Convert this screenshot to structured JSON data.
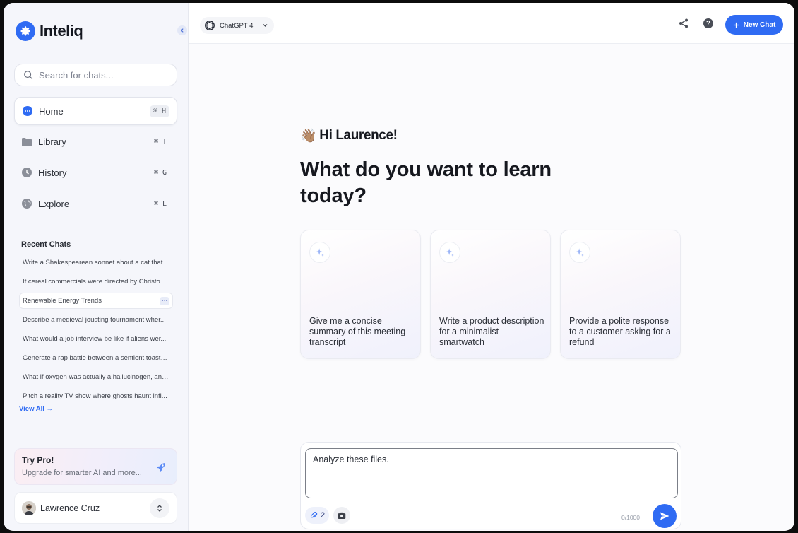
{
  "app": {
    "name": "Inteliq",
    "accent": "#2f6bf3"
  },
  "sidebar": {
    "search_placeholder": "Search for chats...",
    "nav": [
      {
        "label": "Home",
        "shortcut": "⌘ H",
        "icon": "chat-bubble-icon",
        "active": true
      },
      {
        "label": "Library",
        "shortcut": "⌘ T",
        "icon": "folder-icon"
      },
      {
        "label": "History",
        "shortcut": "⌘ G",
        "icon": "clock-icon"
      },
      {
        "label": "Explore",
        "shortcut": "⌘ L",
        "icon": "globe-icon"
      }
    ],
    "recent_title": "Recent Chats",
    "recent": [
      "Write a Shakespearean sonnet about a cat that...",
      "If cereal commercials were directed by Christo...",
      "Renewable Energy Trends",
      "Describe a medieval jousting tournament wher...",
      "What would a job interview be like if aliens wer...",
      "Generate a rap battle between a sentient toaste...",
      "What if oxygen was actually a hallucinogen, and...",
      "Pitch a reality TV show where ghosts haunt infl..."
    ],
    "recent_selected_more": "···",
    "view_all": "View All →",
    "pro": {
      "title": "Try Pro!",
      "subtitle": "Upgrade for smarter AI and more...",
      "icon": "rocket-icon"
    },
    "user": {
      "name": "Lawrence Cruz"
    }
  },
  "topbar": {
    "model": "ChatGPT 4",
    "new_chat": "New Chat",
    "help": "?"
  },
  "main": {
    "greeting_emoji": "👋🏽",
    "greeting": "Hi Laurence!",
    "headline": "What do you want to learn today?",
    "cards": [
      "Give me a concise summary of this meeting transcript",
      "Write a product description for a minimalist smartwatch",
      "Provide a polite response to a customer asking for a refund"
    ],
    "composer": {
      "value": "Analyze these files.",
      "attachments_count": "2",
      "counter": "0/1000"
    }
  }
}
